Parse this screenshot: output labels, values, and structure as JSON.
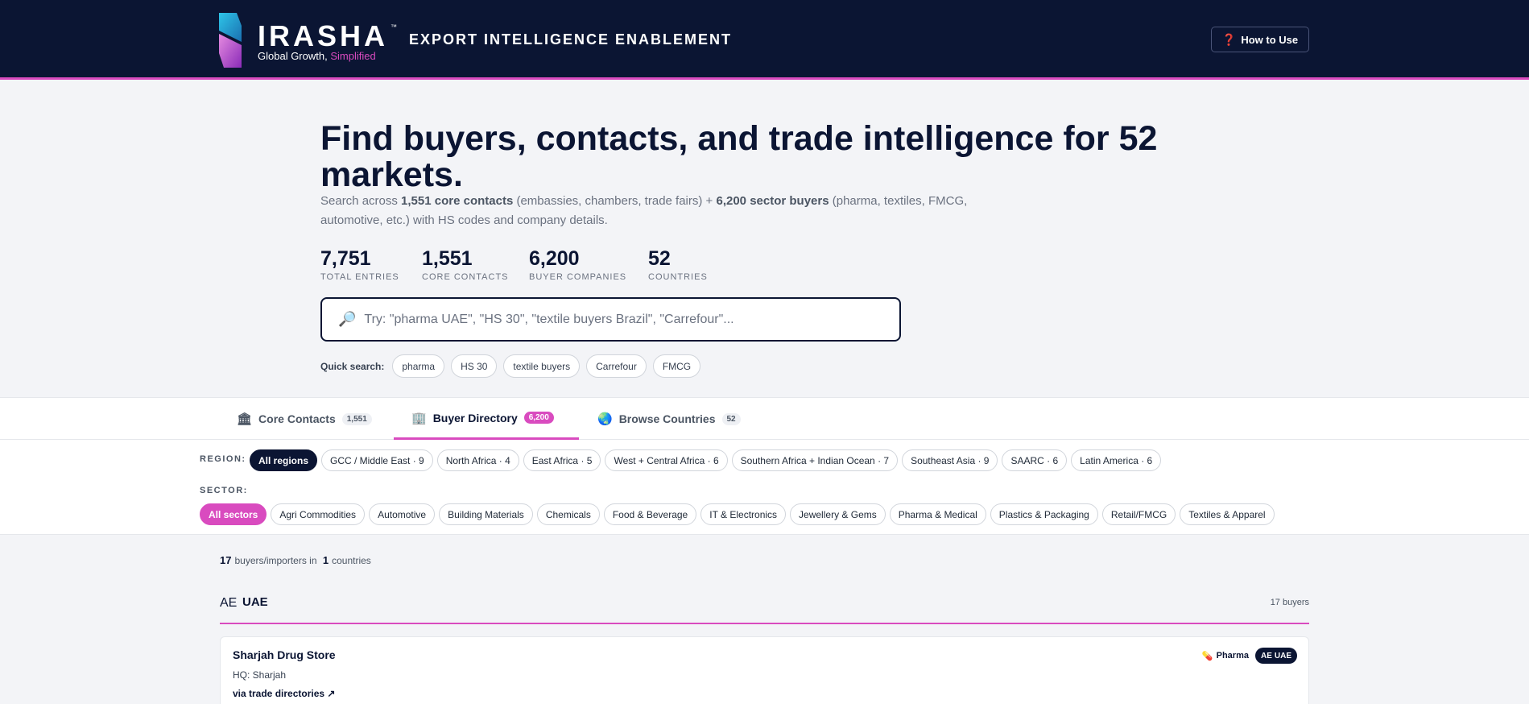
{
  "header": {
    "brand": "IRASHA",
    "brand_tm": "™",
    "tagline_main": "Global Growth, ",
    "tagline_accent": "Simplified",
    "title": "EXPORT INTELLIGENCE ENABLEMENT",
    "how_to_use": "How to Use",
    "how_icon": "question-mark-icon"
  },
  "hero": {
    "headline": "Find buyers, contacts, and trade intelligence for 52 markets.",
    "sub_1": "Search across ",
    "sub_b1": "1,551 core contacts",
    "sub_2": " (embassies, chambers, trade fairs) + ",
    "sub_b2": "6,200 sector buyers",
    "sub_3": " (pharma, textiles, FMCG, automotive, etc.) with HS codes and company details.",
    "stats": [
      {
        "num": "7,751",
        "label": "TOTAL ENTRIES"
      },
      {
        "num": "1,551",
        "label": "CORE CONTACTS"
      },
      {
        "num": "6,200",
        "label": "BUYER COMPANIES"
      },
      {
        "num": "52",
        "label": "COUNTRIES"
      }
    ],
    "search_placeholder": "Try: \"pharma UAE\", \"HS 30\", \"textile buyers Brazil\", \"Carrefour\"...",
    "search_value": "",
    "quick_label": "Quick search:",
    "quick_chips": [
      "pharma",
      "HS 30",
      "textile buyers",
      "Carrefour",
      "FMCG"
    ]
  },
  "tabs": [
    {
      "label": "Core Contacts",
      "count": "1,551",
      "icon": "bank-icon",
      "active": false
    },
    {
      "label": "Buyer Directory",
      "count": "6,200",
      "icon": "building-icon",
      "active": true
    },
    {
      "label": "Browse Countries",
      "count": "52",
      "icon": "globe-icon",
      "active": false
    }
  ],
  "filters": {
    "region_label": "REGION:",
    "regions": [
      "All regions",
      "GCC / Middle East · 9",
      "North Africa · 4",
      "East Africa · 5",
      "West + Central Africa · 6",
      "Southern Africa + Indian Ocean · 7",
      "Southeast Asia · 9",
      "SAARC · 6",
      "Latin America · 6"
    ],
    "sector_label": "SECTOR:",
    "sectors": [
      "All sectors",
      "Agri Commodities",
      "Automotive",
      "Building Materials",
      "Chemicals",
      "Food & Beverage",
      "IT & Electronics",
      "Jewellery & Gems",
      "Pharma & Medical",
      "Plastics & Packaging",
      "Retail/FMCG",
      "Textiles & Apparel"
    ]
  },
  "results": {
    "count": "17",
    "count_text": "buyers/importers in",
    "countries": "1",
    "countries_text": "countries",
    "group": {
      "code": "AE",
      "name": "UAE",
      "count_label": "17 buyers"
    },
    "card": {
      "title": "Sharjah Drug Store",
      "hq": "HQ: Sharjah",
      "source": "via trade directories ↗",
      "sector_tag": "Pharma",
      "country_code": "AE",
      "country_tag": "UAE"
    }
  },
  "colors": {
    "navy": "#0b1533",
    "accent_pink": "#d94bbf",
    "background": "#f3f4f7"
  }
}
